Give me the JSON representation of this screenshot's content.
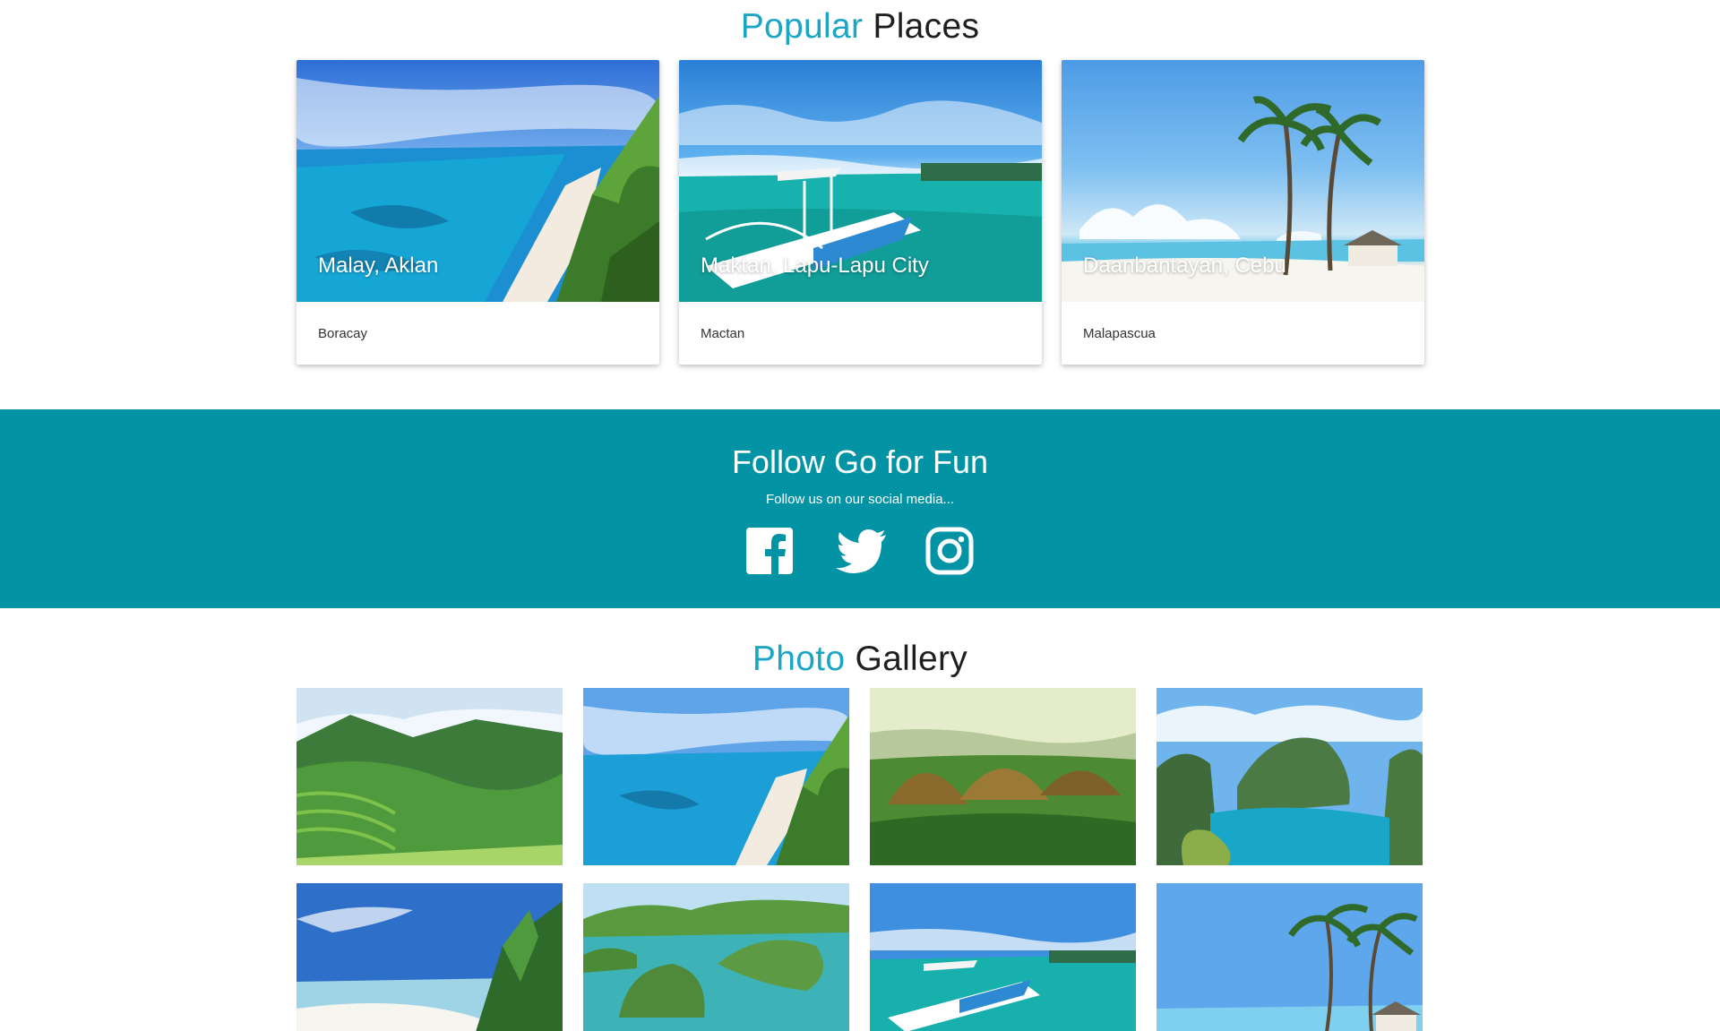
{
  "popular": {
    "title_accent": "Popular",
    "title_rest": "Places",
    "cards": [
      {
        "image_label": "Malay, Aklan",
        "caption": "Boracay"
      },
      {
        "image_label": "Maktan, Lapu-Lapu City",
        "caption": "Mactan"
      },
      {
        "image_label": "Daanbantayan, Cebu",
        "caption": "Malapascua"
      }
    ]
  },
  "follow": {
    "title": "Follow Go for Fun",
    "subtitle": "Follow us on our social media...",
    "icons": [
      "facebook-icon",
      "twitter-icon",
      "instagram-icon"
    ]
  },
  "gallery": {
    "title_accent": "Photo",
    "title_rest": "Gallery"
  },
  "colors": {
    "accent": "#1aa6c4",
    "band": "#0294a5"
  }
}
